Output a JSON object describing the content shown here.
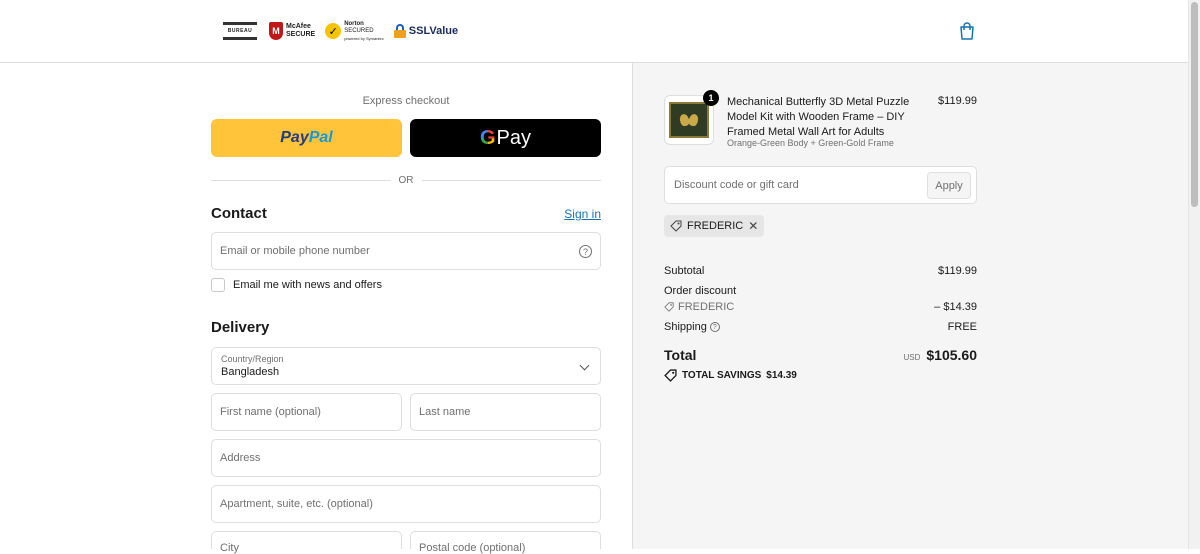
{
  "header": {
    "badges": {
      "logo_text": "BUREAU",
      "mcafee_line1": "McAfee",
      "mcafee_line2": "SECURE",
      "norton_line1": "Norton",
      "norton_line2": "SECURED",
      "norton_line3": "powered by Symantec",
      "ssl": "SSLValue"
    },
    "cart_icon": "shopping-bag-icon"
  },
  "express": {
    "label": "Express checkout",
    "paypal_part1": "Pay",
    "paypal_part2": "Pal",
    "gpay_g": "G",
    "gpay_text": "Pay",
    "or_label": "OR"
  },
  "contact": {
    "title": "Contact",
    "signin": "Sign in",
    "email_placeholder": "Email or mobile phone number",
    "newsletter_label": "Email me with news and offers"
  },
  "delivery": {
    "title": "Delivery",
    "country_label": "Country/Region",
    "country_value": "Bangladesh",
    "first_name_placeholder": "First name (optional)",
    "last_name_placeholder": "Last name",
    "address_placeholder": "Address",
    "apartment_placeholder": "Apartment, suite, etc. (optional)",
    "city_placeholder": "City",
    "postal_placeholder": "Postal code (optional)"
  },
  "order": {
    "product": {
      "title": "Mechanical Butterfly 3D Metal Puzzle Model Kit with Wooden Frame – DIY Framed Metal Wall Art for Adults",
      "variant": "Orange-Green Body + Green-Gold Frame",
      "price": "$119.99",
      "quantity": "1"
    },
    "discount_placeholder": "Discount code or gift card",
    "apply_label": "Apply",
    "applied_code": "FREDERIC",
    "summary": {
      "subtotal_label": "Subtotal",
      "subtotal_value": "$119.99",
      "order_discount_label": "Order discount",
      "discount_code": "FREDERIC",
      "discount_value": "– $14.39",
      "shipping_label": "Shipping",
      "shipping_value": "FREE",
      "total_label": "Total",
      "currency": "USD",
      "total_value": "$105.60",
      "savings_label": "TOTAL SAVINGS",
      "savings_value": "$14.39"
    }
  },
  "colors": {
    "paypal_yellow": "#ffc439",
    "link_blue": "#1773b0",
    "panel_bg": "#f5f5f5"
  }
}
